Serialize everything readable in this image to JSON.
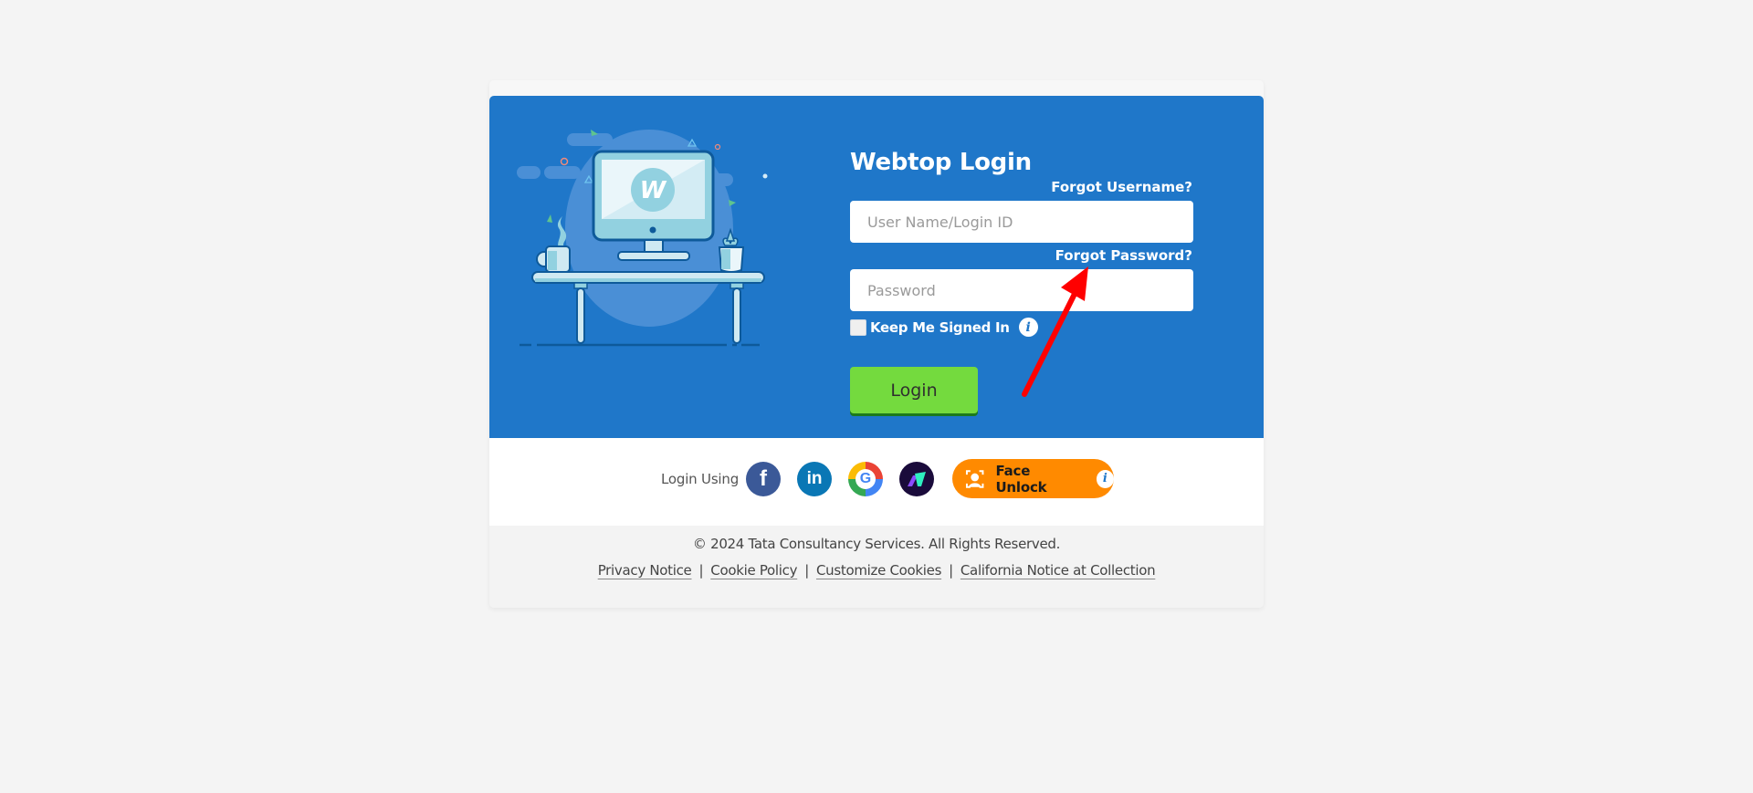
{
  "login": {
    "title": "Webtop Login",
    "forgot_username": "Forgot Username?",
    "forgot_password": "Forgot Password?",
    "username_placeholder": "User Name/Login ID",
    "username_value": "",
    "password_placeholder": "Password",
    "password_value": "",
    "keep_signed_in_label": "Keep Me Signed In",
    "keep_signed_in_checked": false,
    "info_glyph": "i",
    "login_button": "Login"
  },
  "illustration": {
    "logo_letter": "W",
    "icons": [
      "monitor-icon",
      "coffee-mug-icon",
      "plant-pot-icon",
      "desk-icon"
    ]
  },
  "social": {
    "label": "Login Using",
    "providers": [
      {
        "name": "Facebook",
        "glyph": "f",
        "icon": "facebook-icon",
        "color": "#3b5998"
      },
      {
        "name": "LinkedIn",
        "glyph": "in",
        "icon": "linkedin-icon",
        "color": "#0a77b5"
      },
      {
        "name": "Google",
        "glyph": "G",
        "icon": "google-icon",
        "color": "#4285f4"
      },
      {
        "name": "Nova",
        "glyph": "",
        "icon": "nova-icon",
        "color": "#1a0b3b"
      }
    ],
    "face_unlock": {
      "label": "Face Unlock",
      "info_glyph": "i",
      "color": "#ff8a00"
    }
  },
  "footer": {
    "copyright": "© 2024 Tata Consultancy Services. All Rights Reserved.",
    "links": [
      "Privacy Notice",
      "Cookie Policy",
      "Customize Cookies",
      "California Notice at Collection"
    ],
    "separator": "|"
  },
  "colors": {
    "hero_blue": "#1f77c9",
    "login_green": "#74da3e",
    "annotation_arrow": "#ff0000"
  }
}
